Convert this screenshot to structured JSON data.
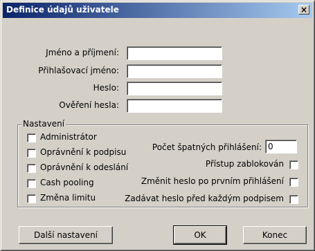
{
  "window": {
    "title": "Definice údajů uživatele",
    "close_glyph": "×"
  },
  "fields": {
    "name": {
      "label": "Jméno a příjmení:",
      "value": ""
    },
    "login": {
      "label": "Přihlašovací jméno:",
      "value": ""
    },
    "password": {
      "label": "Heslo:",
      "value": ""
    },
    "password_confirm": {
      "label": "Ověření hesla:",
      "value": ""
    }
  },
  "settings": {
    "legend": "Nastavení",
    "left_checkboxes": [
      {
        "label": "Administrátor",
        "checked": false
      },
      {
        "label": "Oprávnění k podpisu",
        "checked": false
      },
      {
        "label": "Oprávnění k odeslání",
        "checked": false
      },
      {
        "label": "Cash pooling",
        "checked": false
      },
      {
        "label": "Změna limitu",
        "checked": false
      }
    ],
    "bad_logins": {
      "label": "Počet špatných přihlášení:",
      "value": "0"
    },
    "right_checkboxes": [
      {
        "label": "Přístup zablokován",
        "checked": false
      },
      {
        "label": "Změnit heslo po prvním přihlášení",
        "checked": false
      },
      {
        "label": "Zadávat heslo před každým podpisem",
        "checked": false
      }
    ]
  },
  "buttons": {
    "more_settings": "Další nastavení",
    "ok": "OK",
    "close": "Konec"
  }
}
